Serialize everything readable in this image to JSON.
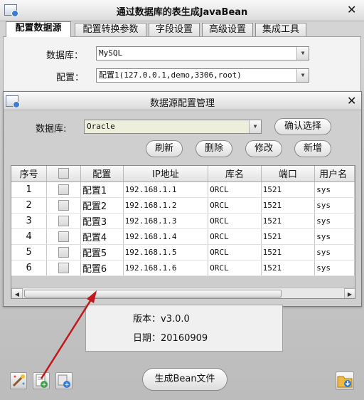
{
  "main": {
    "title": "通过数据库的表生成JavaBean",
    "tabs": [
      {
        "label": "配置数据源"
      },
      {
        "label": "配置转换参数"
      },
      {
        "label": "字段设置"
      },
      {
        "label": "高级设置"
      },
      {
        "label": "集成工具"
      }
    ],
    "db_label": "数据库：",
    "db_value": "MySQL",
    "config_label": "配置：",
    "config_value": "配置1(127.0.0.1,demo,3306,root)"
  },
  "dialog": {
    "title": "数据源配置管理",
    "db_label": "数据库:",
    "db_value": "Oracle",
    "buttons": {
      "confirm": "确认选择",
      "refresh": "刷新",
      "delete": "删除",
      "edit": "修改",
      "add": "新增"
    },
    "table": {
      "headers": [
        "序号",
        "",
        "配置",
        "IP地址",
        "库名",
        "端口",
        "用户名"
      ],
      "rows": [
        {
          "no": "1",
          "name": "配置1",
          "ip": "192.168.1.1",
          "db": "ORCL",
          "port": "1521",
          "user": "sys"
        },
        {
          "no": "2",
          "name": "配置2",
          "ip": "192.168.1.2",
          "db": "ORCL",
          "port": "1521",
          "user": "sys"
        },
        {
          "no": "3",
          "name": "配置3",
          "ip": "192.168.1.3",
          "db": "ORCL",
          "port": "1521",
          "user": "sys"
        },
        {
          "no": "4",
          "name": "配置4",
          "ip": "192.168.1.4",
          "db": "ORCL",
          "port": "1521",
          "user": "sys"
        },
        {
          "no": "5",
          "name": "配置5",
          "ip": "192.168.1.5",
          "db": "ORCL",
          "port": "1521",
          "user": "sys"
        },
        {
          "no": "6",
          "name": "配置6",
          "ip": "192.168.1.6",
          "db": "ORCL",
          "port": "1521",
          "user": "sys"
        }
      ]
    }
  },
  "info": {
    "version": "版本：v3.0.0",
    "date": "日期：20160909"
  },
  "generate_button": "生成Bean文件",
  "colors": {
    "db_combo_bg": "#eeeedd",
    "arrow": "#c0181c"
  },
  "icons": {
    "app": "app-window-icon",
    "tool_1": "magic-wand-icon",
    "tool_2": "add-document-icon",
    "tool_3": "add-config-icon",
    "folder": "folder-download-icon"
  }
}
